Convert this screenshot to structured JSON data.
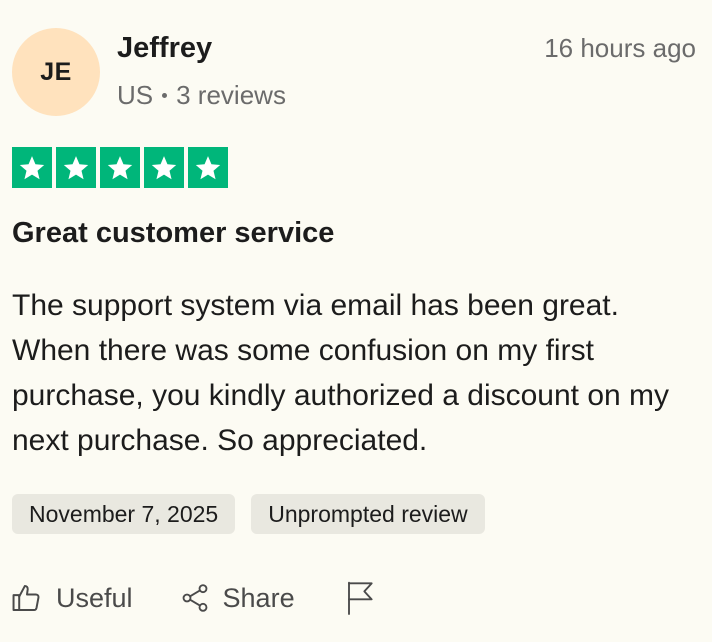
{
  "reviewer": {
    "initials": "JE",
    "name": "Jeffrey",
    "country": "US",
    "reviews_count": "3 reviews"
  },
  "posted": "16 hours ago",
  "rating": {
    "stars": 5,
    "max": 5,
    "color": "#00b67a"
  },
  "review": {
    "title": "Great customer service",
    "body": "The support system via email has been great. When there was some confusion on my first purchase, you kindly authorized a discount on my next purchase. So appreciated."
  },
  "tags": {
    "date": "November 7, 2025",
    "type": "Unprompted review"
  },
  "actions": {
    "useful_label": "Useful",
    "share_label": "Share",
    "useful_icon": "thumbs-up-icon",
    "share_icon": "share-icon",
    "report_icon": "flag-icon"
  }
}
